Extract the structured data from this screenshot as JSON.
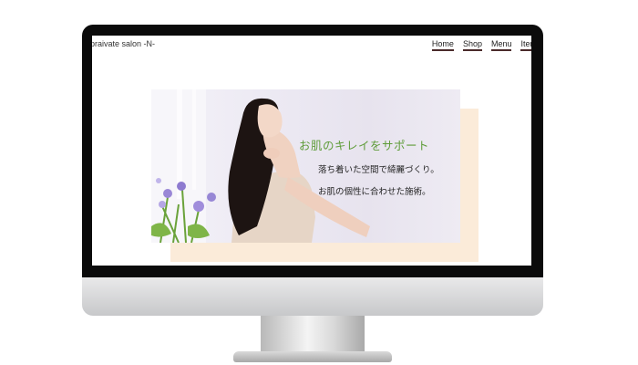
{
  "site": {
    "title": "praivate salon -N-"
  },
  "nav": {
    "items": [
      {
        "label": "Home"
      },
      {
        "label": "Shop"
      },
      {
        "label": "Menu"
      },
      {
        "label": "Item"
      }
    ]
  },
  "hero": {
    "title": "お肌のキレイをサポート",
    "line1": "落ち着いた空間で綺麗づくり。",
    "line2": "お肌の個性に合わせた施術。"
  },
  "colors": {
    "accent_green": "#5f9c3a",
    "panel_beige": "#fbebd9",
    "nav_underline": "#4a2a2a"
  }
}
